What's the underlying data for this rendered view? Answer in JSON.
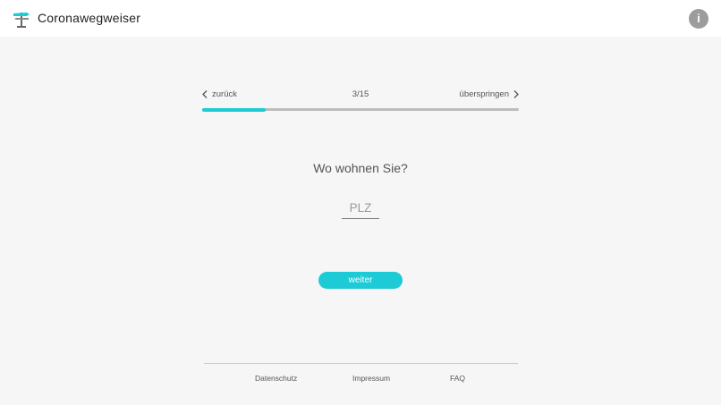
{
  "header": {
    "title": "Coronawegweiser",
    "logo_icon": "signpost-icon",
    "info_label": "i"
  },
  "wizard": {
    "back_label": "zurück",
    "step_label": "3/15",
    "skip_label": "überspringen",
    "progress": 0.2,
    "question": "Wo wohnen Sie?",
    "plz_placeholder": "PLZ",
    "plz_value": "",
    "next_label": "weiter"
  },
  "footer": {
    "links": [
      "Datenschutz",
      "Impressum",
      "FAQ"
    ]
  },
  "colors": {
    "accent": "#1ccbd6",
    "background": "#f6f6f6",
    "header_bg": "#ffffff",
    "info_button": "#9c9c9c",
    "track": "#bdbdbd"
  }
}
